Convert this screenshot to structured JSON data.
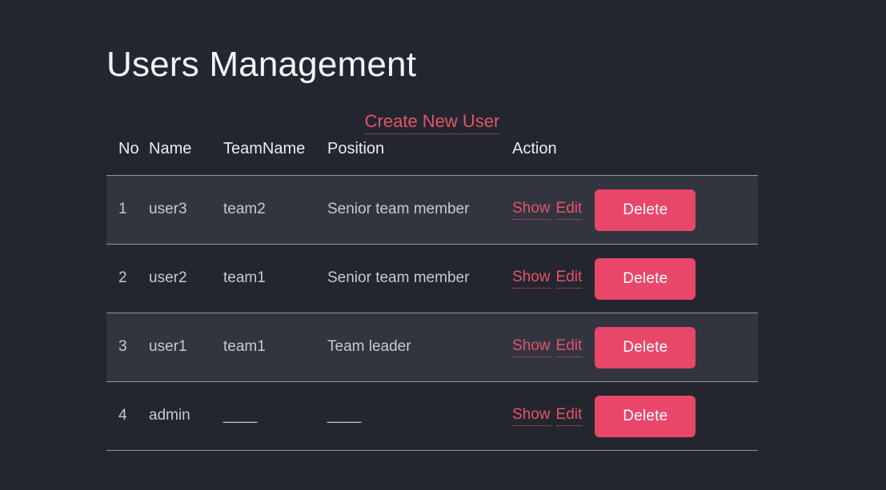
{
  "page": {
    "title": "Users Management",
    "background_color": "#24262f",
    "accent_color": "#e8476a",
    "link_color": "#e4536b"
  },
  "toolbar": {
    "create_label": "Create New User"
  },
  "table": {
    "columns": [
      "No",
      "Name",
      "TeamName",
      "Position",
      "Action"
    ],
    "rows": [
      {
        "no": "1",
        "name": "user3",
        "team": "team2",
        "position": "Senior team member",
        "show_label": "Show",
        "edit_label": "Edit",
        "delete_label": "Delete",
        "highlighted": true
      },
      {
        "no": "2",
        "name": "user2",
        "team": "team1",
        "position": "Senior team member",
        "show_label": "Show",
        "edit_label": "Edit",
        "delete_label": "Delete",
        "highlighted": false
      },
      {
        "no": "3",
        "name": "user1",
        "team": "team1",
        "position": "Team leader",
        "show_label": "Show",
        "edit_label": "Edit",
        "delete_label": "Delete",
        "highlighted": true
      },
      {
        "no": "4",
        "name": "admin",
        "team": "____",
        "position": "____",
        "show_label": "Show",
        "edit_label": "Edit",
        "delete_label": "Delete",
        "highlighted": false
      }
    ]
  }
}
